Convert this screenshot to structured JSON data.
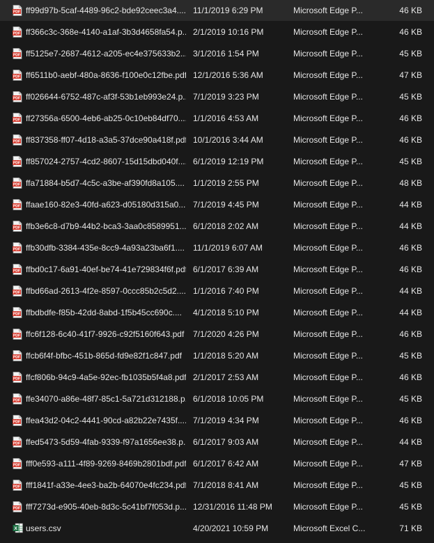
{
  "colors": {
    "background": "#191919",
    "text": "#e6e6e6",
    "pdf_icon_red": "#d63b2f",
    "excel_green": "#1e7145"
  },
  "files": [
    {
      "name": "ff99d97b-5caf-4489-96c2-bde92ceec3a4....",
      "date": "11/1/2019 6:29 PM",
      "type": "Microsoft Edge P...",
      "size": "46 KB",
      "icon": "pdf-icon"
    },
    {
      "name": "ff366c3c-368e-4140-a1af-3b3d4658fa54.p...",
      "date": "2/1/2019 10:16 PM",
      "type": "Microsoft Edge P...",
      "size": "46 KB",
      "icon": "pdf-icon"
    },
    {
      "name": "ff5125e7-2687-4612-a205-ec4e375633b2....",
      "date": "3/1/2016 1:54 PM",
      "type": "Microsoft Edge P...",
      "size": "45 KB",
      "icon": "pdf-icon"
    },
    {
      "name": "ff6511b0-aebf-480a-8636-f100e0c12fbe.pdf",
      "date": "12/1/2016 5:36 AM",
      "type": "Microsoft Edge P...",
      "size": "47 KB",
      "icon": "pdf-icon"
    },
    {
      "name": "ff026644-6752-487c-af3f-53b1eb993e24.p...",
      "date": "7/1/2019 3:23 PM",
      "type": "Microsoft Edge P...",
      "size": "45 KB",
      "icon": "pdf-icon"
    },
    {
      "name": "ff27356a-6500-4eb6-ab25-0c10eb84df70....",
      "date": "1/1/2016 4:53 AM",
      "type": "Microsoft Edge P...",
      "size": "46 KB",
      "icon": "pdf-icon"
    },
    {
      "name": "ff837358-ff07-4d18-a3a5-37dce90a418f.pdf",
      "date": "10/1/2016 3:44 AM",
      "type": "Microsoft Edge P...",
      "size": "46 KB",
      "icon": "pdf-icon"
    },
    {
      "name": "ff857024-2757-4cd2-8607-15d15dbd040f....",
      "date": "6/1/2019 12:19 PM",
      "type": "Microsoft Edge P...",
      "size": "45 KB",
      "icon": "pdf-icon"
    },
    {
      "name": "ffa71884-b5d7-4c5c-a3be-af390fd8a105....",
      "date": "1/1/2019 2:55 PM",
      "type": "Microsoft Edge P...",
      "size": "48 KB",
      "icon": "pdf-icon"
    },
    {
      "name": "ffaae160-82e3-40fd-a623-d05180d315a0....",
      "date": "7/1/2019 4:45 PM",
      "type": "Microsoft Edge P...",
      "size": "44 KB",
      "icon": "pdf-icon"
    },
    {
      "name": "ffb3e6c8-d7b9-44b2-bca3-3aa0c8589951....",
      "date": "6/1/2018 2:02 AM",
      "type": "Microsoft Edge P...",
      "size": "44 KB",
      "icon": "pdf-icon"
    },
    {
      "name": "ffb30dfb-3384-435e-8cc9-4a93a23ba6f1....",
      "date": "11/1/2019 6:07 AM",
      "type": "Microsoft Edge P...",
      "size": "46 KB",
      "icon": "pdf-icon"
    },
    {
      "name": "ffbd0c17-6a91-40ef-be74-41e729834f6f.pdf",
      "date": "6/1/2017 6:39 AM",
      "type": "Microsoft Edge P...",
      "size": "46 KB",
      "icon": "pdf-icon"
    },
    {
      "name": "ffbd66ad-2613-4f2e-8597-0ccc85b2c5d2....",
      "date": "1/1/2016 7:40 PM",
      "type": "Microsoft Edge P...",
      "size": "44 KB",
      "icon": "pdf-icon"
    },
    {
      "name": "ffbdbdfe-f85b-42dd-8abd-1f5b45cc690c....",
      "date": "4/1/2018 5:10 PM",
      "type": "Microsoft Edge P...",
      "size": "44 KB",
      "icon": "pdf-icon"
    },
    {
      "name": "ffc6f128-6c40-41f7-9926-c92f5160f643.pdf",
      "date": "7/1/2020 4:26 PM",
      "type": "Microsoft Edge P...",
      "size": "46 KB",
      "icon": "pdf-icon"
    },
    {
      "name": "ffcb6f4f-bfbc-451b-865d-fd9e82f1c847.pdf",
      "date": "1/1/2018 5:20 AM",
      "type": "Microsoft Edge P...",
      "size": "45 KB",
      "icon": "pdf-icon"
    },
    {
      "name": "ffcf806b-94c9-4a5e-92ec-fb1035b5f4a8.pdf",
      "date": "2/1/2017 2:53 AM",
      "type": "Microsoft Edge P...",
      "size": "46 KB",
      "icon": "pdf-icon"
    },
    {
      "name": "ffe34070-a86e-48f7-85c1-5a721d312188.p...",
      "date": "6/1/2018 10:05 PM",
      "type": "Microsoft Edge P...",
      "size": "45 KB",
      "icon": "pdf-icon"
    },
    {
      "name": "ffea43d2-04c2-4441-90cd-a82b22e7435f....",
      "date": "7/1/2019 4:34 PM",
      "type": "Microsoft Edge P...",
      "size": "46 KB",
      "icon": "pdf-icon"
    },
    {
      "name": "ffed5473-5d59-4fab-9339-f97a1656ee38.p...",
      "date": "6/1/2017 9:03 AM",
      "type": "Microsoft Edge P...",
      "size": "44 KB",
      "icon": "pdf-icon"
    },
    {
      "name": "fff0e593-a111-4f89-9269-8469b2801bdf.pdf",
      "date": "6/1/2017 6:42 AM",
      "type": "Microsoft Edge P...",
      "size": "47 KB",
      "icon": "pdf-icon"
    },
    {
      "name": "fff1841f-a33e-4ee3-ba2b-64070e4fc234.pdf",
      "date": "7/1/2018 8:41 AM",
      "type": "Microsoft Edge P...",
      "size": "45 KB",
      "icon": "pdf-icon"
    },
    {
      "name": "fff7273d-e905-40eb-8d3c-5c41bf7f053d.p...",
      "date": "12/31/2016 11:48 PM",
      "type": "Microsoft Edge P...",
      "size": "45 KB",
      "icon": "pdf-icon"
    },
    {
      "name": "users.csv",
      "date": "4/20/2021 10:59 PM",
      "type": "Microsoft Excel C...",
      "size": "71 KB",
      "icon": "excel-csv-icon"
    }
  ]
}
